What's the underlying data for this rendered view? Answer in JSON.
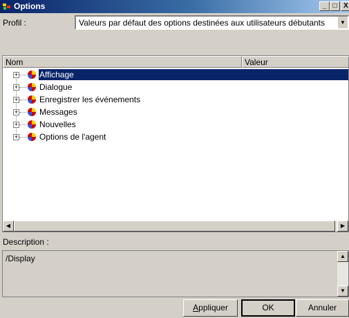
{
  "window": {
    "title": "Options",
    "minimize_glyph": "_",
    "maximize_glyph": "□",
    "close_glyph": "X"
  },
  "profile": {
    "label": "Profil :",
    "value": "Valeurs par défaut des options destinées aux utilisateurs débutants",
    "arrow_glyph": "▼"
  },
  "columns": {
    "name": "Nom",
    "value": "Valeur"
  },
  "tree": {
    "expander_glyph": "+",
    "items": [
      {
        "label": "Affichage",
        "selected": true
      },
      {
        "label": "Dialogue",
        "selected": false
      },
      {
        "label": "Enregistrer les événements",
        "selected": false
      },
      {
        "label": "Messages",
        "selected": false
      },
      {
        "label": "Nouvelles",
        "selected": false
      },
      {
        "label": "Options de l'agent",
        "selected": false
      }
    ]
  },
  "hscroll": {
    "left_glyph": "◀",
    "right_glyph": "▶"
  },
  "description": {
    "label": "Description :",
    "text": "/Display",
    "up_glyph": "▲",
    "down_glyph": "▼"
  },
  "buttons": {
    "apply_first": "A",
    "apply_rest": "ppliquer",
    "ok": "OK",
    "cancel": "Annuler"
  },
  "icons": {
    "title": "options-app-icon",
    "category": "category-ball-icon"
  },
  "colors": {
    "selection": "#0a246a",
    "titlebar_start": "#0a246a",
    "titlebar_end": "#a6caf0",
    "face": "#d4d0c8"
  }
}
